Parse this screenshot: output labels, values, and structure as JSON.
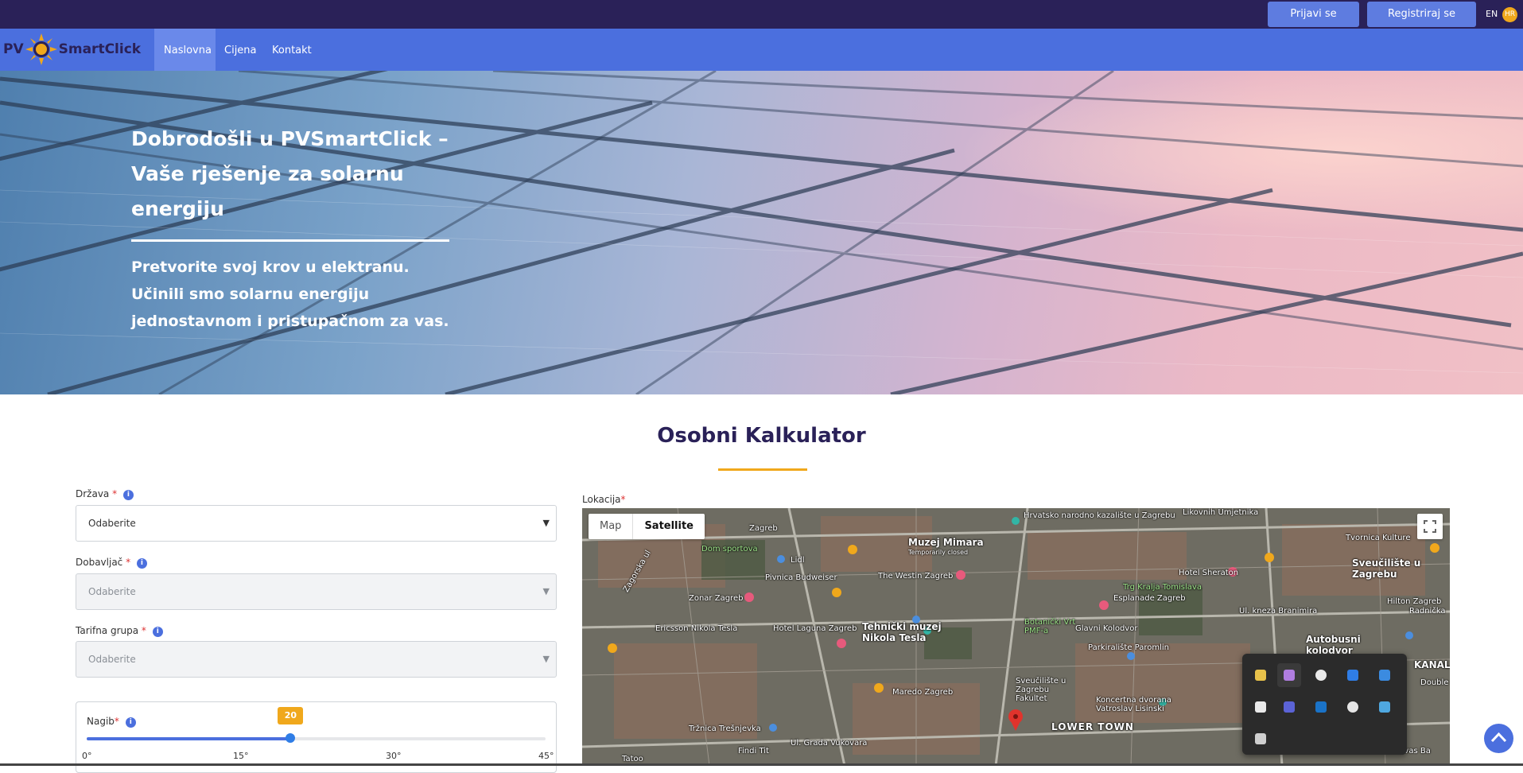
{
  "topbar": {
    "login_label": "Prijavi se",
    "register_label": "Registriraj se",
    "lang_en": "EN",
    "lang_hr": "HR"
  },
  "logo": {
    "prefix": "PV",
    "brand": "SmartClick"
  },
  "nav": {
    "items": [
      {
        "label": "Naslovna",
        "active": true
      },
      {
        "label": "Cijena",
        "active": false
      },
      {
        "label": "Kontakt",
        "active": false
      }
    ]
  },
  "hero": {
    "title": "Dobrodošli u PVSmartClick – Vaše rješenje za solarnu energiju",
    "subtitle": "Pretvorite svoj krov u elektranu. Učinili smo solarnu energiju jednostavnom i pristupačnom za vas."
  },
  "calculator": {
    "title": "Osobni Kalkulator",
    "country": {
      "label": "Država",
      "required_mark": "*",
      "value": "Odaberite"
    },
    "supplier": {
      "label": "Dobavljač",
      "required_mark": "*",
      "value": "Odaberite"
    },
    "tariff": {
      "label": "Tarifna grupa",
      "required_mark": "*",
      "value": "Odaberite"
    },
    "tilt": {
      "label": "Nagib",
      "required_mark": "*",
      "value": "20",
      "value_num": 20,
      "min": 0,
      "max": 45,
      "ticks": [
        "0°",
        "15°",
        "30°",
        "45°"
      ]
    },
    "location": {
      "label": "Lokacija",
      "required_mark": "*"
    }
  },
  "map": {
    "tab_map": "Map",
    "tab_satellite": "Satellite",
    "labels": {
      "l1": "Hrvatsko narodno kazalište u Zagrebu",
      "l2": "Likovnih Umjetnika",
      "l3": "Tvornica Kulture",
      "l4": "Muzej Mimara",
      "l5": "Temporarily closed",
      "l6": "Dom sportova",
      "l7": "Lidl",
      "l8": "Pivnica Budweiser",
      "l9": "The Westin Zagreb",
      "l10": "Sveučilište u Zagrebu",
      "l11": "Hotel Sheraton",
      "l12": "Trg Kralja Tomislava",
      "l13": "Esplanade Zagreb",
      "l14": "Zonar Zagreb",
      "l15": "Ericsson Nikola Tesla",
      "l16": "Hotel Laguna Zagreb",
      "l17": "Tehnički muzej Nikola Tesla",
      "l18": "Botanički Vrt PMF-a",
      "l19": "Glavni Kolodvor",
      "l20": "Ul. kneza Branimira",
      "l21": "Hilton Zagreb",
      "l22": "Parkiralište Paromlin",
      "l23": "Autobusni kolodvor Zagreb",
      "l24": "Maredo Zagreb",
      "l25": "Sveučilište u Zagrebu Fakultet",
      "l26": "Koncertna dvorana Vatroslav Lisinski",
      "l27": "LOWER TOWN",
      "l28": "KANAL",
      "l29": "Tržnica Trešnjevka",
      "l30": "Ul. Grada Vukovara",
      "l31": "Tatoo",
      "l32": "Findi Tit",
      "l33": "Vivas Ba",
      "l34": "Zagreb",
      "l35": "Zagorska ul",
      "l36": "Double",
      "l37": "Radnička"
    }
  },
  "colors": {
    "topbar": "#2a2158",
    "nav": "#4b6fde",
    "accent": "#f0a81c",
    "title": "#2a2158"
  }
}
